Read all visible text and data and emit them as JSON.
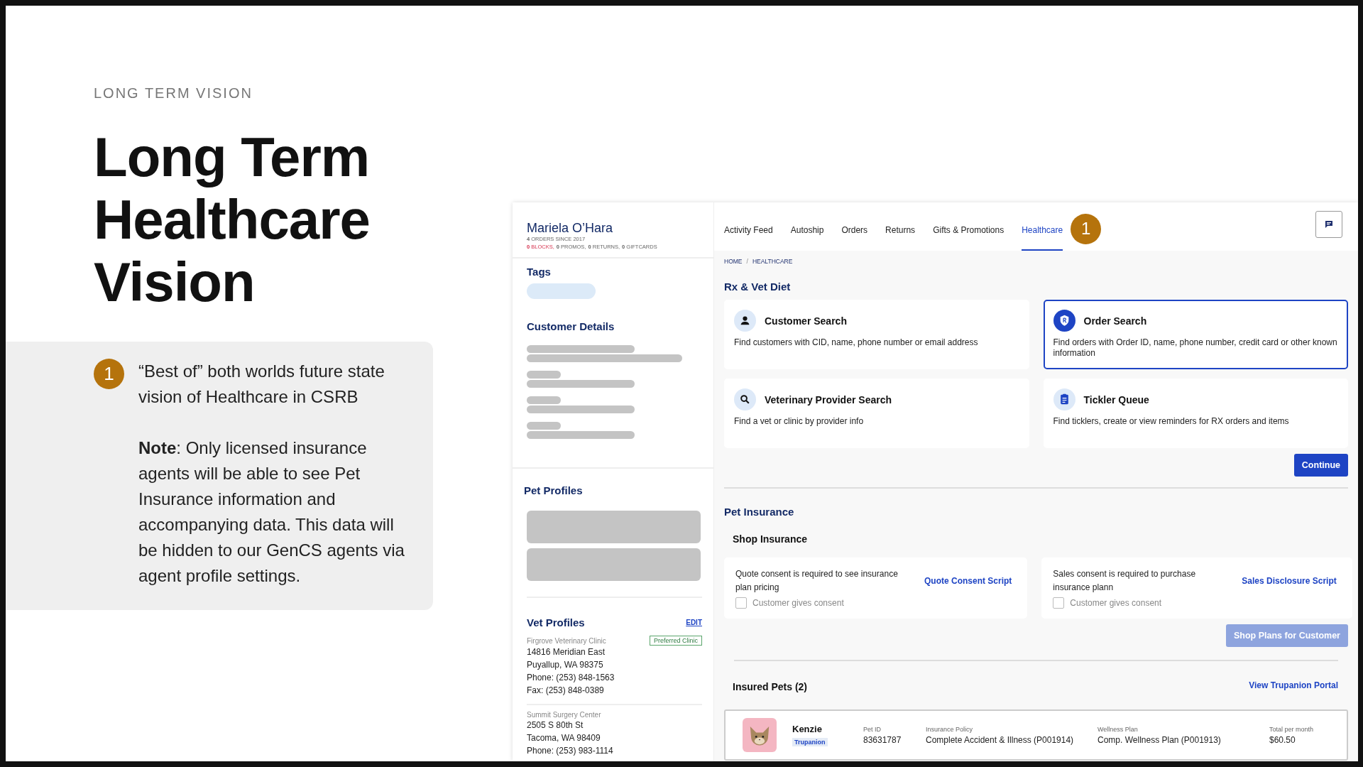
{
  "slide": {
    "eyebrow": "LONG TERM VISION",
    "title": "Long Term Healthcare Vision"
  },
  "callout": {
    "badge": "1",
    "text": "“Best of” both worlds future state vision of Healthcare in CSRB",
    "note": "**Note**: Only licensed insurance agents will be able to see Pet Insurance information and accompanying data. This data will be hidden to our GenCS agents via agent profile settings."
  },
  "app": {
    "customer": {
      "name": "Mariela O’Hara",
      "orders": "**4** ORDERS SINCE 2017",
      "stats": [
        {
          "text": "**0** BLOCKS,",
          "alert": true
        },
        {
          "text": "**0** PROMOS,",
          "alert": false
        },
        {
          "text": "**0** RETURNS,",
          "alert": false
        },
        {
          "text": "**0** GIFTCARDS",
          "alert": false
        }
      ]
    },
    "sidebar": {
      "tags_title": "Tags",
      "details_title": "Customer Details",
      "pets_title": "Pet Profiles",
      "vet": {
        "title": "Vet Profiles",
        "edit": "EDIT",
        "clinics": [
          {
            "name": "Firgrove Veterinary Clinic",
            "badge": "Preferred Clinic",
            "lines": [
              "14816 Meridian East",
              "Puyallup, WA 98375",
              "Phone: (253) 848-1563",
              "Fax: (253) 848-0389"
            ]
          },
          {
            "name": "Summit Surgery Center",
            "lines": [
              "2505 S 80th St",
              "Tacoma, WA 98409",
              "Phone: (253) 983-1114"
            ]
          }
        ]
      }
    },
    "tabs": [
      {
        "label": "Activity Feed",
        "selected": false
      },
      {
        "label": "Autoship",
        "selected": false
      },
      {
        "label": "Orders",
        "selected": false
      },
      {
        "label": "Returns",
        "selected": false
      },
      {
        "label": "Gifts & Promotions",
        "selected": false
      },
      {
        "label": "Healthcare",
        "selected": true
      }
    ],
    "tab_badge": "1",
    "breadcrumb": {
      "items": [
        "HOME",
        "HEALTHCARE"
      ],
      "separator": "/"
    },
    "rx": {
      "title": "Rx & Vet Diet",
      "cards": [
        {
          "kind": "person",
          "title": "Customer Search",
          "desc": "Find customers with CID, name, phone number or email address",
          "selected": false
        },
        {
          "kind": "rx",
          "title": "Order Search",
          "desc": "Find orders with Order ID, name, phone number, credit card or other known information",
          "selected": true
        },
        {
          "kind": "search",
          "title": "Veterinary Provider Search",
          "desc": "Find a vet or clinic by provider info",
          "selected": false
        },
        {
          "kind": "clipboard",
          "title": "Tickler Queue",
          "desc": "Find ticklers, create or view reminders for RX orders and items",
          "selected": false
        }
      ],
      "continue": "Continue"
    },
    "insurance": {
      "title": "Pet Insurance",
      "shop_title": "Shop Insurance",
      "consents": [
        {
          "text": "Quote consent is required to see insurance plan pricing",
          "link": "Quote Consent Script",
          "checkbox": "Customer gives consent",
          "checked": false
        },
        {
          "text": "Sales consent is required to purchase insurance plann",
          "link": "Sales Disclosure Script",
          "checkbox": "Customer gives consent",
          "checked": false
        }
      ],
      "shop_button": {
        "label": "Shop Plans for Customer",
        "disabled": true
      },
      "insured_title": "Insured Pets (2)",
      "portal": "View Trupanion Portal",
      "pets": [
        {
          "name": "Kenzie",
          "provider": "Trupanion",
          "fields": [
            {
              "label": "Pet ID",
              "value": "83631787"
            },
            {
              "label": "Insurance Policy",
              "value": "Complete Accident & Illness (P001914)"
            },
            {
              "label": "Wellness Plan",
              "value": "Comp. Wellness Plan (P001913)"
            },
            {
              "label": "Total per month",
              "value": "$60.50"
            }
          ]
        }
      ]
    }
  }
}
